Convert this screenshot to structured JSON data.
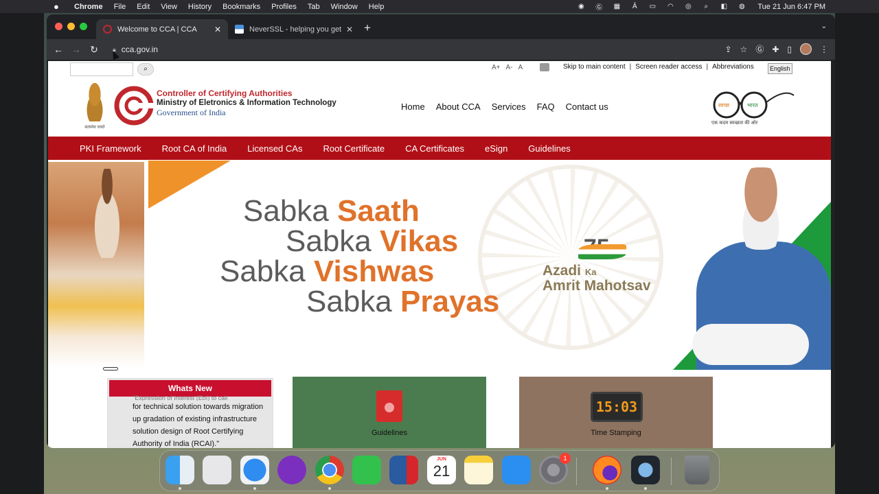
{
  "menubar": {
    "app": "Chrome",
    "items": [
      "File",
      "Edit",
      "View",
      "History",
      "Bookmarks",
      "Profiles",
      "Tab",
      "Window",
      "Help"
    ],
    "clock": "Tue 21 Jun  6:47 PM",
    "status_icons": [
      "record-icon",
      "grammarly-icon",
      "keyboard-icon",
      "text-input-icon",
      "battery-icon",
      "wifi-icon",
      "user-icon",
      "spotlight-icon",
      "control-center-icon",
      "siri-icon"
    ]
  },
  "browser": {
    "tabs": [
      {
        "title": "Welcome to CCA | CCA",
        "active": true
      },
      {
        "title": "NeverSSL - helping you get on",
        "active": false
      }
    ],
    "url": "cca.gov.in"
  },
  "site": {
    "font_controls": [
      "A+",
      "A-",
      "A"
    ],
    "access_links": [
      "Skip to main content",
      "Screen reader access",
      "Abbreviations"
    ],
    "lang_button": "English",
    "emblem_motto": "सत्यमेव जयते",
    "org": {
      "line1": "Controller of Certifying Authorities",
      "line2": "Ministry of Eletronics & Information Technology",
      "line3": "Government of India"
    },
    "main_nav": [
      "Home",
      "About CCA",
      "Services",
      "FAQ",
      "Contact us"
    ],
    "swachh": {
      "word1": "स्वच्छ",
      "word2": "भारत",
      "tagline": "एक कदम स्वच्छता की ओर"
    },
    "red_nav": [
      "PKI Framework",
      "Root CA of India",
      "Licensed CAs",
      "Root Certificate",
      "CA Certificates",
      "eSign",
      "Guidelines"
    ],
    "banner": {
      "lines": [
        {
          "grey": "Sabka",
          "orange": "Saath"
        },
        {
          "grey": "Sabka",
          "orange": "Vikas"
        },
        {
          "grey": "Sabka",
          "orange": "Vishwas"
        },
        {
          "grey": "Sabka",
          "orange": "Prayas"
        }
      ],
      "azadi_number": "75",
      "azadi_line1": "Azadi",
      "azadi_ka": "Ka",
      "azadi_line2": "Amrit Mahotsav"
    },
    "whats_new": {
      "title": "Whats New",
      "cutoff": "\"Expression of Interest (EoI) to call",
      "text": "for technical solution towards migration up gradation of existing infrastructure solution design of Root Certifying Authority of India (RCAI).\""
    },
    "cards": [
      {
        "label": "Guidelines",
        "icon": "book-icon"
      },
      {
        "label": "Time Stamping",
        "icon": "digital-clock-icon",
        "clock_text": "15:03"
      }
    ]
  },
  "dock": {
    "calendar_month": "JUN",
    "calendar_day": "21",
    "settings_badge": "1",
    "apps": [
      "finder-icon",
      "launchpad-icon",
      "safari-icon",
      "podcasts-icon",
      "chrome-icon",
      "facetime-icon",
      "screen-recorder-icon",
      "calendar-icon",
      "notes-icon",
      "app-store-icon",
      "system-preferences-icon",
      "firefox-icon",
      "quicktime-icon",
      "trash-icon"
    ]
  }
}
